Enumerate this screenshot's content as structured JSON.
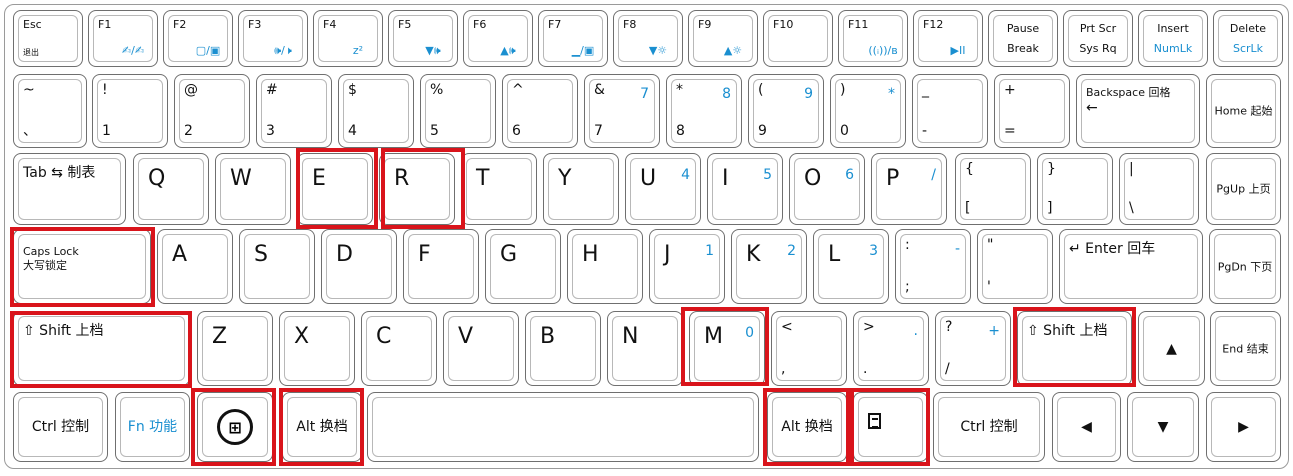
{
  "colors": {
    "highlight": "#d9141b",
    "secondary_legend": "#1a8fd0",
    "key_outline": "#6f6f6f"
  },
  "keyboard": {
    "function_row": [
      {
        "id": "esc",
        "top": "Esc",
        "sub": "退出"
      },
      {
        "id": "f1",
        "top": "F1",
        "icon": "✍/✍"
      },
      {
        "id": "f2",
        "top": "F2",
        "icon": "▢/▣"
      },
      {
        "id": "f3",
        "top": "F3",
        "icon": "🕪/🕨"
      },
      {
        "id": "f4",
        "top": "F4",
        "icon": "z²"
      },
      {
        "id": "f5",
        "top": "F5",
        "icon": "▼🕪"
      },
      {
        "id": "f6",
        "top": "F6",
        "icon": "▲🕪"
      },
      {
        "id": "f7",
        "top": "F7",
        "icon": "▁/▣"
      },
      {
        "id": "f8",
        "top": "F8",
        "icon": "▼☼"
      },
      {
        "id": "f9",
        "top": "F9",
        "icon": "▲☼"
      },
      {
        "id": "f10",
        "top": "F10",
        "icon": ""
      },
      {
        "id": "f11",
        "top": "F11",
        "icon": "((ᵢ))/ʙ"
      },
      {
        "id": "f12",
        "top": "F12",
        "icon": "▶II"
      },
      {
        "id": "pause",
        "top": "Pause",
        "bottom": "Break"
      },
      {
        "id": "prtscr",
        "top": "Prt Scr",
        "bottom": "Sys Rq"
      },
      {
        "id": "insert",
        "top": "Insert",
        "bottom": "NumLk"
      },
      {
        "id": "delete",
        "top": "Delete",
        "bottom": "ScrLk"
      }
    ],
    "number_row": [
      {
        "id": "tilde",
        "top": "~",
        "bottom": "、"
      },
      {
        "id": "k1",
        "top": "!",
        "bottom": "1"
      },
      {
        "id": "k2",
        "top": "@",
        "bottom": "2"
      },
      {
        "id": "k3",
        "top": "#",
        "bottom": "3"
      },
      {
        "id": "k4",
        "top": "$",
        "bottom": "4"
      },
      {
        "id": "k5",
        "top": "%",
        "bottom": "5"
      },
      {
        "id": "k6",
        "top": "^",
        "bottom": "6"
      },
      {
        "id": "k7",
        "top": "&",
        "bottom": "7",
        "alt": "7"
      },
      {
        "id": "k8",
        "top": "*",
        "bottom": "8",
        "alt": "8"
      },
      {
        "id": "k9",
        "top": "(",
        "bottom": "9",
        "alt": "9"
      },
      {
        "id": "k0",
        "top": ")",
        "bottom": "0",
        "alt": "*"
      },
      {
        "id": "minus",
        "top": "_",
        "bottom": "-"
      },
      {
        "id": "equal",
        "top": "+",
        "bottom": "="
      },
      {
        "id": "backspace",
        "top": "Backspace 回格",
        "bottom": "←"
      },
      {
        "id": "home",
        "label": "Home 起始"
      }
    ],
    "q_row": [
      {
        "id": "tab",
        "label": "Tab ⇆ 制表"
      },
      {
        "id": "q",
        "label": "Q"
      },
      {
        "id": "w",
        "label": "W"
      },
      {
        "id": "e",
        "label": "E"
      },
      {
        "id": "r",
        "label": "R"
      },
      {
        "id": "t",
        "label": "T"
      },
      {
        "id": "y",
        "label": "Y"
      },
      {
        "id": "u",
        "label": "U",
        "alt": "4"
      },
      {
        "id": "i",
        "label": "I",
        "alt": "5"
      },
      {
        "id": "o",
        "label": "O",
        "alt": "6"
      },
      {
        "id": "p",
        "label": "P",
        "alt": "/"
      },
      {
        "id": "lbrace",
        "top": "{",
        "bottom": "["
      },
      {
        "id": "rbrace",
        "top": "}",
        "bottom": "]"
      },
      {
        "id": "pipe",
        "top": "|",
        "bottom": "\\"
      },
      {
        "id": "pgup",
        "label": "PgUp 上页"
      }
    ],
    "a_row": [
      {
        "id": "capslock",
        "top": "Caps Lock",
        "bottom": "大写锁定"
      },
      {
        "id": "a",
        "label": "A"
      },
      {
        "id": "s",
        "label": "S"
      },
      {
        "id": "d",
        "label": "D"
      },
      {
        "id": "f",
        "label": "F"
      },
      {
        "id": "g",
        "label": "G"
      },
      {
        "id": "h",
        "label": "H"
      },
      {
        "id": "j",
        "label": "J",
        "alt": "1"
      },
      {
        "id": "k",
        "label": "K",
        "alt": "2"
      },
      {
        "id": "l",
        "label": "L",
        "alt": "3"
      },
      {
        "id": "semicolon",
        "top": ":",
        "bottom": ";",
        "alt": "-"
      },
      {
        "id": "quote",
        "top": "\"",
        "bottom": "'"
      },
      {
        "id": "enter",
        "label": "↵ Enter 回车"
      },
      {
        "id": "pgdn",
        "label": "PgDn 下页"
      }
    ],
    "z_row": [
      {
        "id": "lshift",
        "label": "⇧ Shift 上档"
      },
      {
        "id": "z",
        "label": "Z"
      },
      {
        "id": "x",
        "label": "X"
      },
      {
        "id": "c",
        "label": "C"
      },
      {
        "id": "v",
        "label": "V"
      },
      {
        "id": "b",
        "label": "B"
      },
      {
        "id": "n",
        "label": "N"
      },
      {
        "id": "m",
        "label": "M",
        "alt": "0"
      },
      {
        "id": "comma",
        "top": "<",
        "bottom": ","
      },
      {
        "id": "period",
        "top": ">",
        "bottom": ".",
        "alt": "."
      },
      {
        "id": "slash",
        "top": "?",
        "bottom": "/",
        "alt": "+"
      },
      {
        "id": "rshift",
        "label": "⇧ Shift 上档"
      },
      {
        "id": "up",
        "label": "▲"
      },
      {
        "id": "end",
        "label": "End 结束"
      }
    ],
    "bottom_row": [
      {
        "id": "lctrl",
        "label": "Ctrl 控制"
      },
      {
        "id": "fn",
        "label": "Fn 功能"
      },
      {
        "id": "win",
        "label": "⊞"
      },
      {
        "id": "lalt",
        "label": "Alt 换档"
      },
      {
        "id": "space",
        "label": ""
      },
      {
        "id": "ralt",
        "label": "Alt 换档"
      },
      {
        "id": "menu",
        "label": ""
      },
      {
        "id": "rctrl",
        "label": "Ctrl 控制"
      },
      {
        "id": "left",
        "label": "◀"
      },
      {
        "id": "down",
        "label": "▼"
      },
      {
        "id": "right",
        "label": "▶"
      }
    ],
    "highlighted_keys": [
      "e",
      "r",
      "capslock",
      "lshift",
      "win",
      "lalt",
      "m",
      "rshift",
      "ralt",
      "menu"
    ]
  }
}
